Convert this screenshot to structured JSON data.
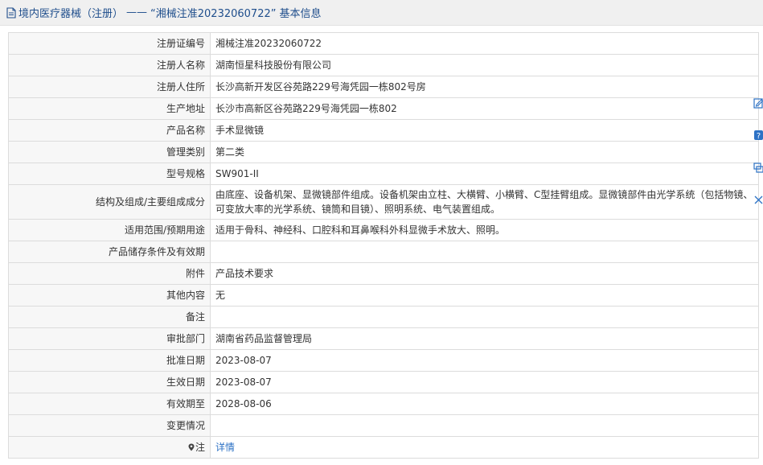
{
  "header": {
    "category": "境内医疗器械（注册）",
    "separator": "——",
    "reg_quote": "“湘械注准20232060722”",
    "suffix": "基本信息"
  },
  "rows": [
    {
      "label": "注册证编号",
      "value": "湘械注准20232060722"
    },
    {
      "label": "注册人名称",
      "value": "湖南恒星科技股份有限公司"
    },
    {
      "label": "注册人住所",
      "value": "长沙高新开发区谷苑路229号海凭园一栋802号房"
    },
    {
      "label": "生产地址",
      "value": "长沙市高新区谷苑路229号海凭园一栋802"
    },
    {
      "label": "产品名称",
      "value": "手术显微镜"
    },
    {
      "label": "管理类别",
      "value": "第二类"
    },
    {
      "label": "型号规格",
      "value": "SW901-II"
    },
    {
      "label": "结构及组成/主要组成成分",
      "value": "由底座、设备机架、显微镜部件组成。设备机架由立柱、大横臂、小横臂、C型挂臂组成。显微镜部件由光学系统（包括物镜、可变放大率的光学系统、镜筒和目镜）、照明系统、电气装置组成。"
    },
    {
      "label": "适用范围/预期用途",
      "value": "适用于骨科、神经科、口腔科和耳鼻喉科外科显微手术放大、照明。"
    },
    {
      "label": "产品储存条件及有效期",
      "value": ""
    },
    {
      "label": "附件",
      "value": "产品技术要求"
    },
    {
      "label": "其他内容",
      "value": "无"
    },
    {
      "label": "备注",
      "value": ""
    },
    {
      "label": "审批部门",
      "value": "湖南省药品监督管理局"
    },
    {
      "label": "批准日期",
      "value": "2023-08-07"
    },
    {
      "label": "生效日期",
      "value": "2023-08-07"
    },
    {
      "label": "有效期至",
      "value": "2028-08-06"
    },
    {
      "label": "变更情况",
      "value": ""
    }
  ],
  "note_row": {
    "label": "注",
    "link": "详情"
  },
  "side_tools": [
    "edit-icon",
    "help-icon",
    "share-icon",
    "close-icon"
  ],
  "colors": {
    "header_text": "#1f4e8c",
    "link": "#2d72c5",
    "label_bg": "#f7f7f7",
    "border": "#dcdcdc"
  }
}
